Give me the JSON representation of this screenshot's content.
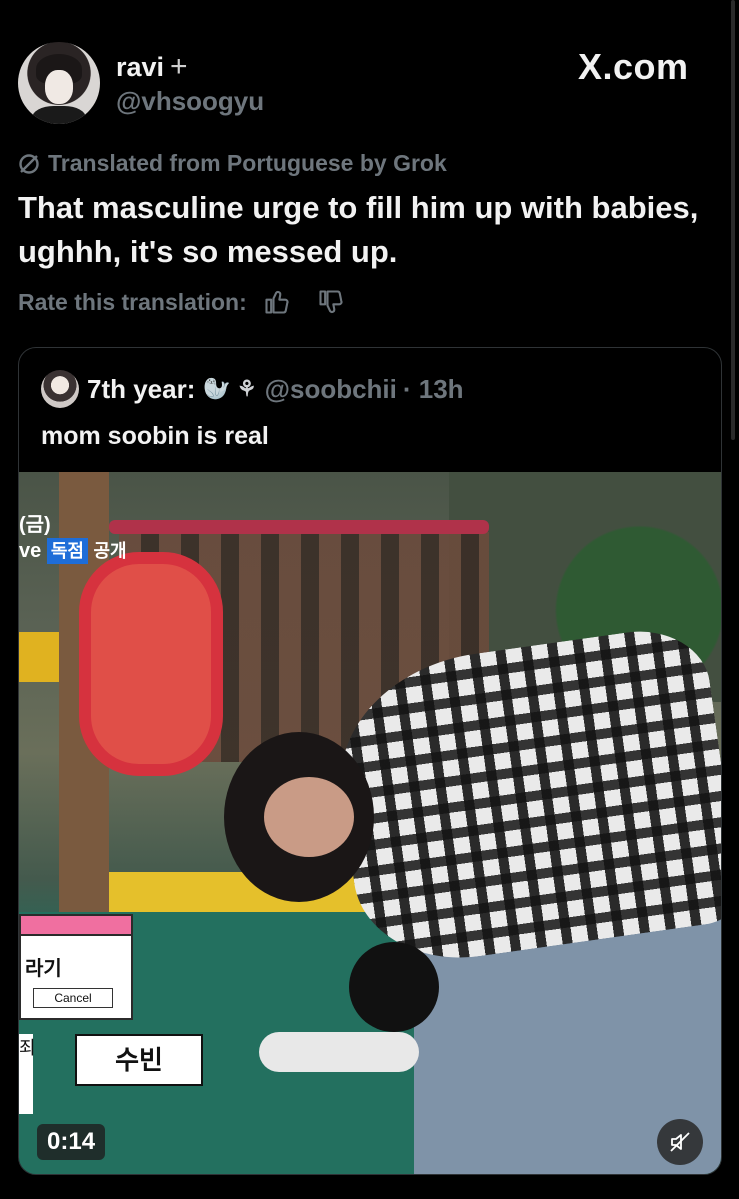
{
  "author": {
    "name": "ravi",
    "handle": "@vhsoogyu",
    "badge_icon": "plus-sparkle-icon"
  },
  "source_label": "X.com",
  "translation": {
    "label": "Translated from Portuguese by Grok",
    "text": "That masculine urge to fill him up with babies, ughhh, it's so messed up.",
    "rate_label": "Rate this translation:"
  },
  "quoted": {
    "name": "7th year:",
    "emojis": "🦭 ⚘",
    "handle": "@soobchii",
    "time": "· 13h",
    "text": "mom soobin is real"
  },
  "video": {
    "overlay_top_line1": "(금)",
    "overlay_top_line2_prefix": "ve",
    "overlay_top_badge": "독점",
    "overlay_top_suffix": "공개",
    "dialog_text": "라기",
    "dialog_button": "Cancel",
    "name_label": "수빈",
    "side_label": "죄",
    "timer": "0:14",
    "muted": true
  },
  "colors": {
    "background": "#000000",
    "muted_text": "#6e767d",
    "text": "#f2f2f2",
    "border": "#2f3336"
  }
}
